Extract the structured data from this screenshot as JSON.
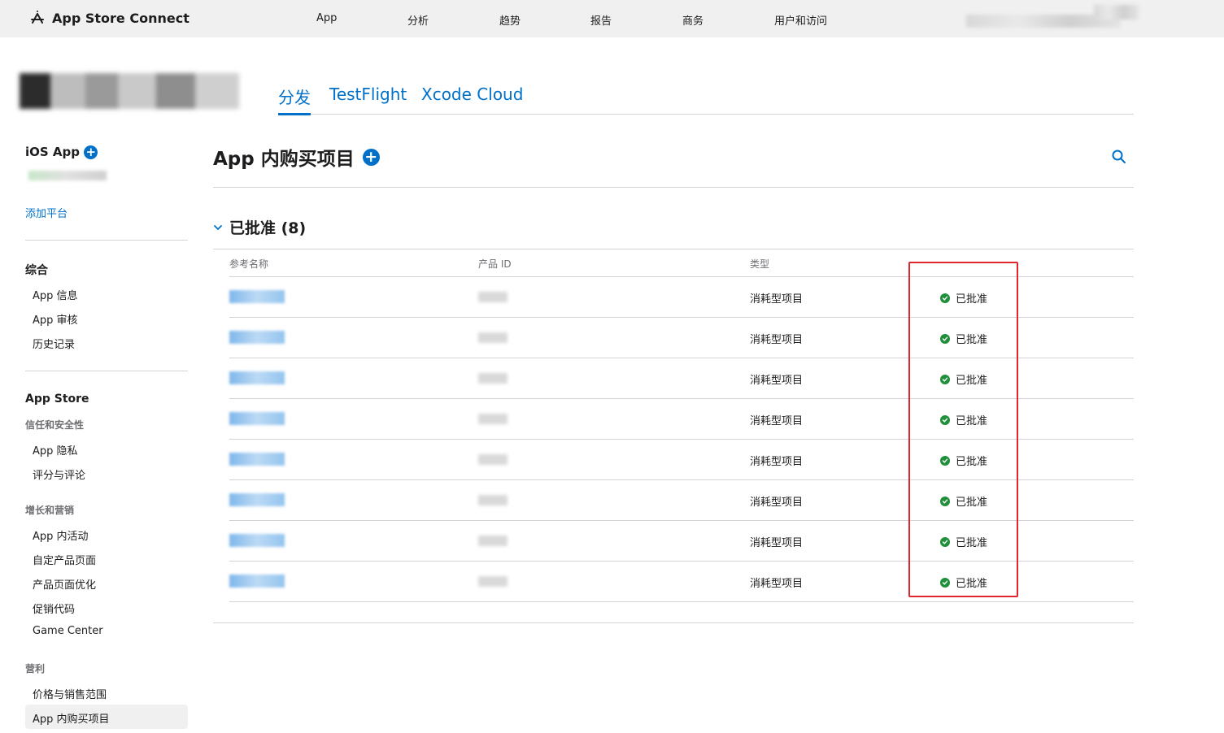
{
  "topbar": {
    "brand": "App Store Connect",
    "nav": [
      "App",
      "分析",
      "趋势",
      "报告",
      "商务",
      "用户和访问"
    ]
  },
  "header": {
    "tabs": [
      "分发",
      "TestFlight",
      "Xcode Cloud"
    ],
    "active_tab": "分发"
  },
  "sidebar": {
    "platform": "iOS App",
    "add_platform": "添加平台",
    "general_heading": "综合",
    "general_items": [
      "App 信息",
      "App 审核",
      "历史记录"
    ],
    "store_heading": "App Store",
    "trust_heading": "信任和安全性",
    "trust_items": [
      "App 隐私",
      "评分与评论"
    ],
    "growth_heading": "增长和营销",
    "growth_items": [
      "App 内活动",
      "自定产品页面",
      "产品页面优化",
      "促销代码",
      "Game Center"
    ],
    "monetize_heading": "营利",
    "monetize_items": [
      "价格与销售范围",
      "App 内购买项目"
    ],
    "selected_item": "App 内购买项目"
  },
  "main": {
    "title": "App 内购买项目",
    "section_title": "已批准 (8)",
    "columns": [
      "参考名称",
      "产品 ID",
      "类型"
    ],
    "rows": [
      {
        "type": "消耗型项目",
        "status": "已批准"
      },
      {
        "type": "消耗型项目",
        "status": "已批准"
      },
      {
        "type": "消耗型项目",
        "status": "已批准"
      },
      {
        "type": "消耗型项目",
        "status": "已批准"
      },
      {
        "type": "消耗型项目",
        "status": "已批准"
      },
      {
        "type": "消耗型项目",
        "status": "已批准"
      },
      {
        "type": "消耗型项目",
        "status": "已批准"
      },
      {
        "type": "消耗型项目",
        "status": "已批准"
      }
    ]
  },
  "colors": {
    "accent": "#0070c9",
    "approved": "#1f8f3a",
    "highlight": "#e0262b"
  }
}
